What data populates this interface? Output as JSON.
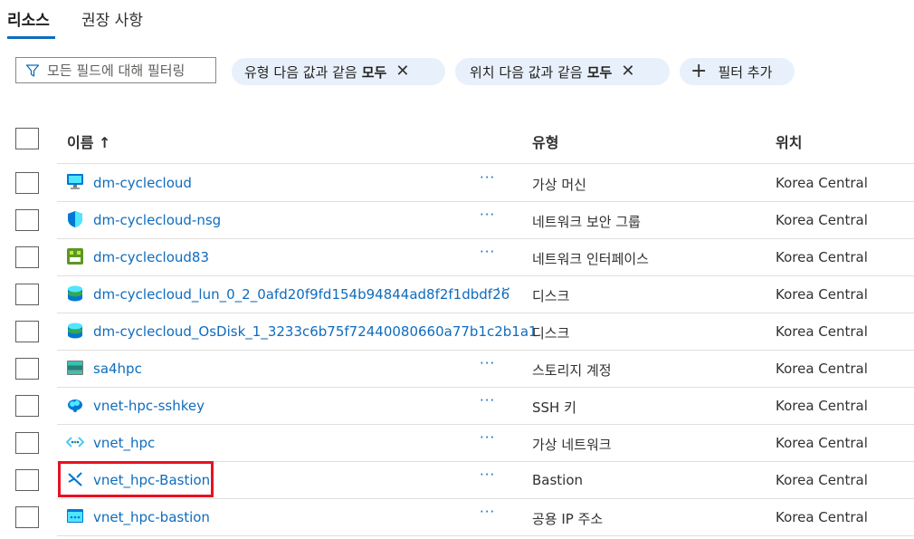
{
  "tabs": [
    {
      "label": "리소스",
      "active": true
    },
    {
      "label": "권장 사항",
      "active": false
    }
  ],
  "filter": {
    "placeholder": "모든 필드에 대해 필터링",
    "pills": [
      {
        "prefix": "유형",
        "middle": "다음 값과 같음",
        "value": "모두"
      },
      {
        "prefix": "위치",
        "middle": "다음 값과 같음",
        "value": "모두"
      }
    ],
    "add_label": "필터 추가"
  },
  "table": {
    "headers": {
      "name": "이름 ↑",
      "type": "유형",
      "location": "위치"
    },
    "rows": [
      {
        "name": "dm-cyclecloud",
        "type": "가상 머신",
        "location": "Korea Central",
        "icon": "virtual-machine-icon"
      },
      {
        "name": "dm-cyclecloud-nsg",
        "type": "네트워크 보안 그룹",
        "location": "Korea Central",
        "icon": "network-security-group-icon"
      },
      {
        "name": "dm-cyclecloud83",
        "type": "네트워크 인터페이스",
        "location": "Korea Central",
        "icon": "network-interface-icon"
      },
      {
        "name": "dm-cyclecloud_lun_0_2_0afd20f9fd154b94844ad8f2f1dbdf26",
        "type": "디스크",
        "location": "Korea Central",
        "icon": "disk-icon"
      },
      {
        "name": "dm-cyclecloud_OsDisk_1_3233c6b75f72440080660a77b1c2b1a1",
        "type": "디스크",
        "location": "Korea Central",
        "icon": "disk-icon"
      },
      {
        "name": "sa4hpc",
        "type": "스토리지 계정",
        "location": "Korea Central",
        "icon": "storage-account-icon"
      },
      {
        "name": "vnet-hpc-sshkey",
        "type": "SSH 키",
        "location": "Korea Central",
        "icon": "ssh-key-icon"
      },
      {
        "name": "vnet_hpc",
        "type": "가상 네트워크",
        "location": "Korea Central",
        "icon": "virtual-network-icon"
      },
      {
        "name": "vnet_hpc-Bastion",
        "type": "Bastion",
        "location": "Korea Central",
        "icon": "bastion-icon"
      },
      {
        "name": "vnet_hpc-bastion",
        "type": "공용 IP 주소",
        "location": "Korea Central",
        "icon": "public-ip-icon"
      }
    ],
    "more_label": "···"
  },
  "colors": {
    "link": "#0f6cbd",
    "pill_bg": "#e8f1fb",
    "highlight": "#e81123"
  }
}
